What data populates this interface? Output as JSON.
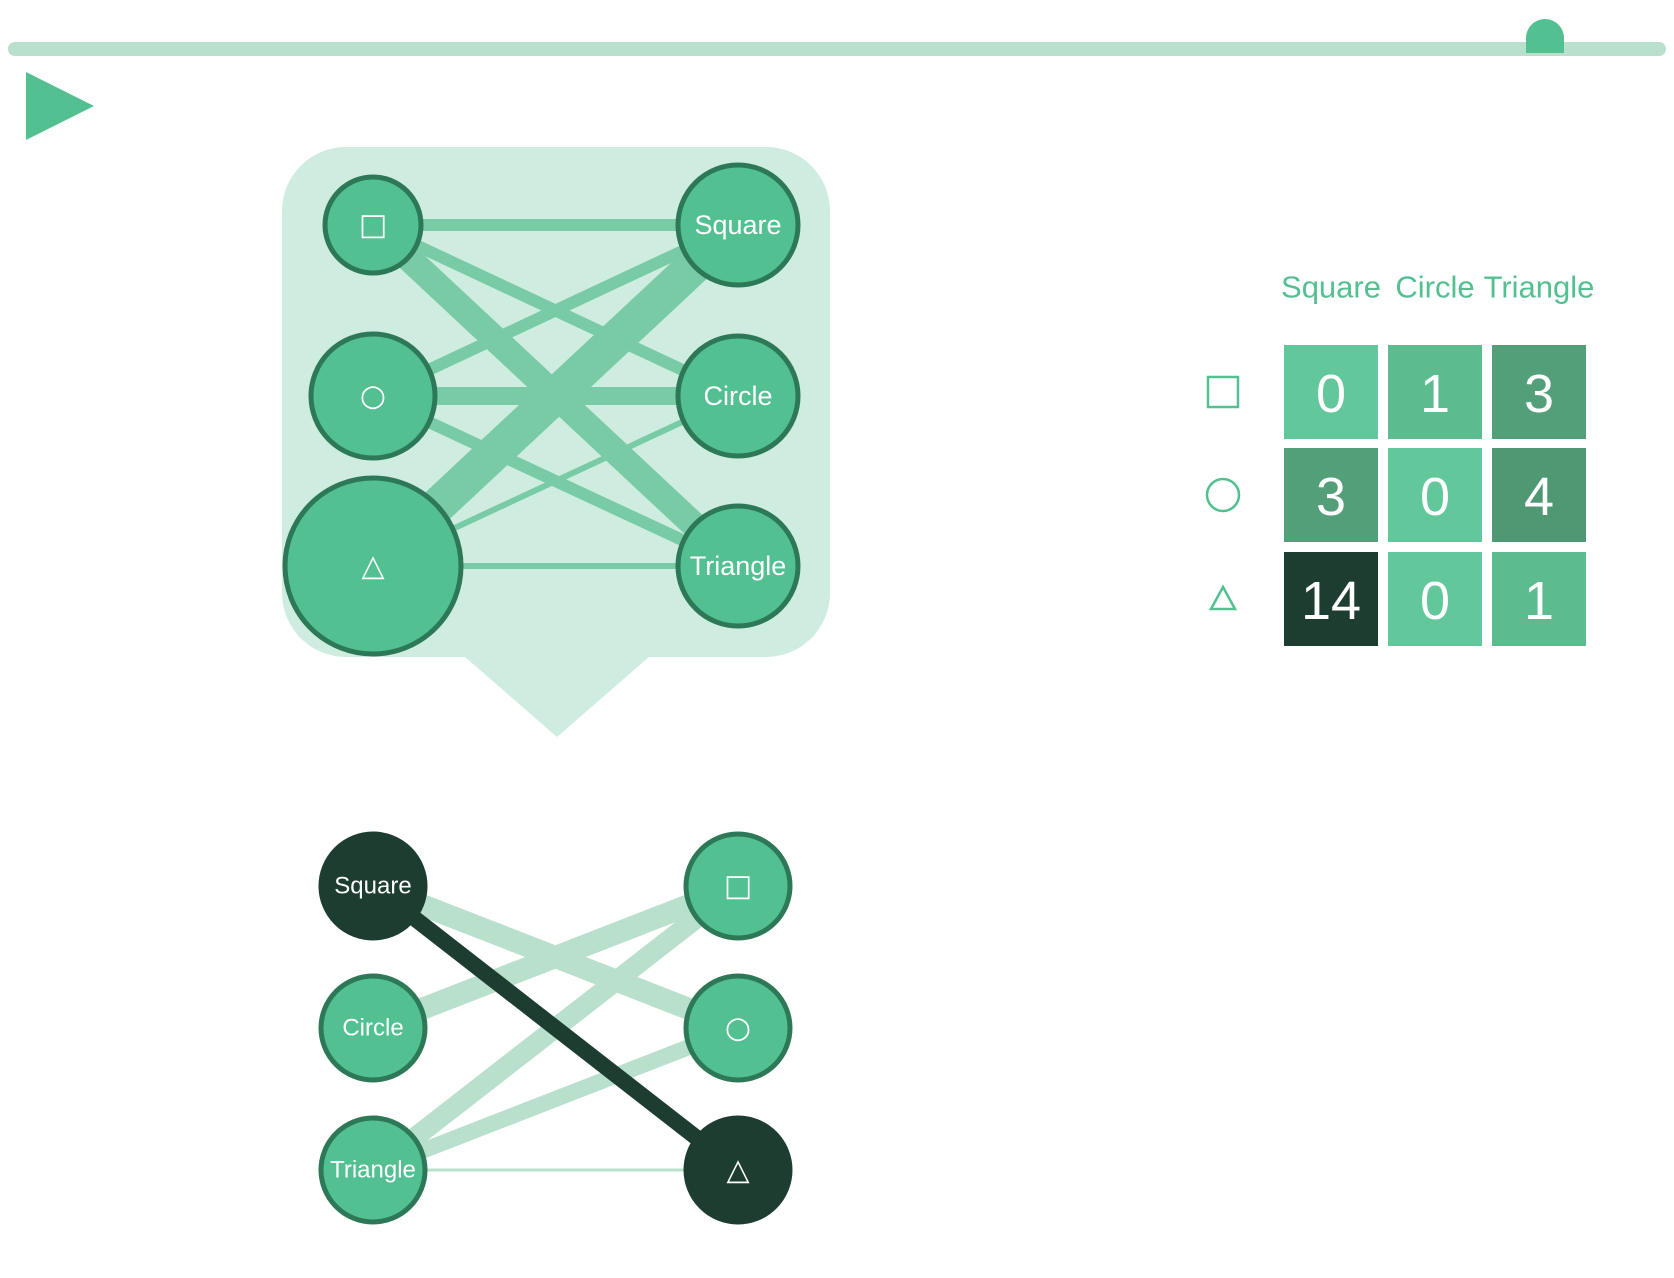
{
  "colors": {
    "accent": "#52c090",
    "accent_light": "#b8e0cc",
    "panel_bg": "#cfece0",
    "node_stroke": "#2d7857",
    "dark": "#1e3d31",
    "edge": "#78cba5",
    "edge_faded": "#b8e0cc"
  },
  "controls": {
    "play_icon": "play-icon",
    "slider_value": 0.925
  },
  "top_diagram": {
    "left_nodes": [
      {
        "id": "square",
        "glyph": "□"
      },
      {
        "id": "circle",
        "glyph": "○"
      },
      {
        "id": "triangle",
        "glyph": "△"
      }
    ],
    "right_nodes": [
      {
        "id": "square",
        "label": "Square"
      },
      {
        "id": "circle",
        "label": "Circle"
      },
      {
        "id": "triangle",
        "label": "Triangle"
      }
    ]
  },
  "bottom_diagram": {
    "left_nodes": [
      {
        "id": "square",
        "label": "Square",
        "highlighted": true
      },
      {
        "id": "circle",
        "label": "Circle",
        "highlighted": false
      },
      {
        "id": "triangle",
        "label": "Triangle",
        "highlighted": false
      }
    ],
    "right_nodes": [
      {
        "id": "square",
        "glyph": "□",
        "highlighted": false
      },
      {
        "id": "circle",
        "glyph": "○",
        "highlighted": false
      },
      {
        "id": "triangle",
        "glyph": "△",
        "highlighted": true
      }
    ]
  },
  "matrix": {
    "columns": [
      "Square",
      "Circle",
      "Triangle"
    ],
    "rows": [
      "□",
      "○",
      "△"
    ],
    "values": [
      [
        0,
        1,
        3
      ],
      [
        3,
        0,
        4
      ],
      [
        14,
        0,
        1
      ]
    ]
  }
}
